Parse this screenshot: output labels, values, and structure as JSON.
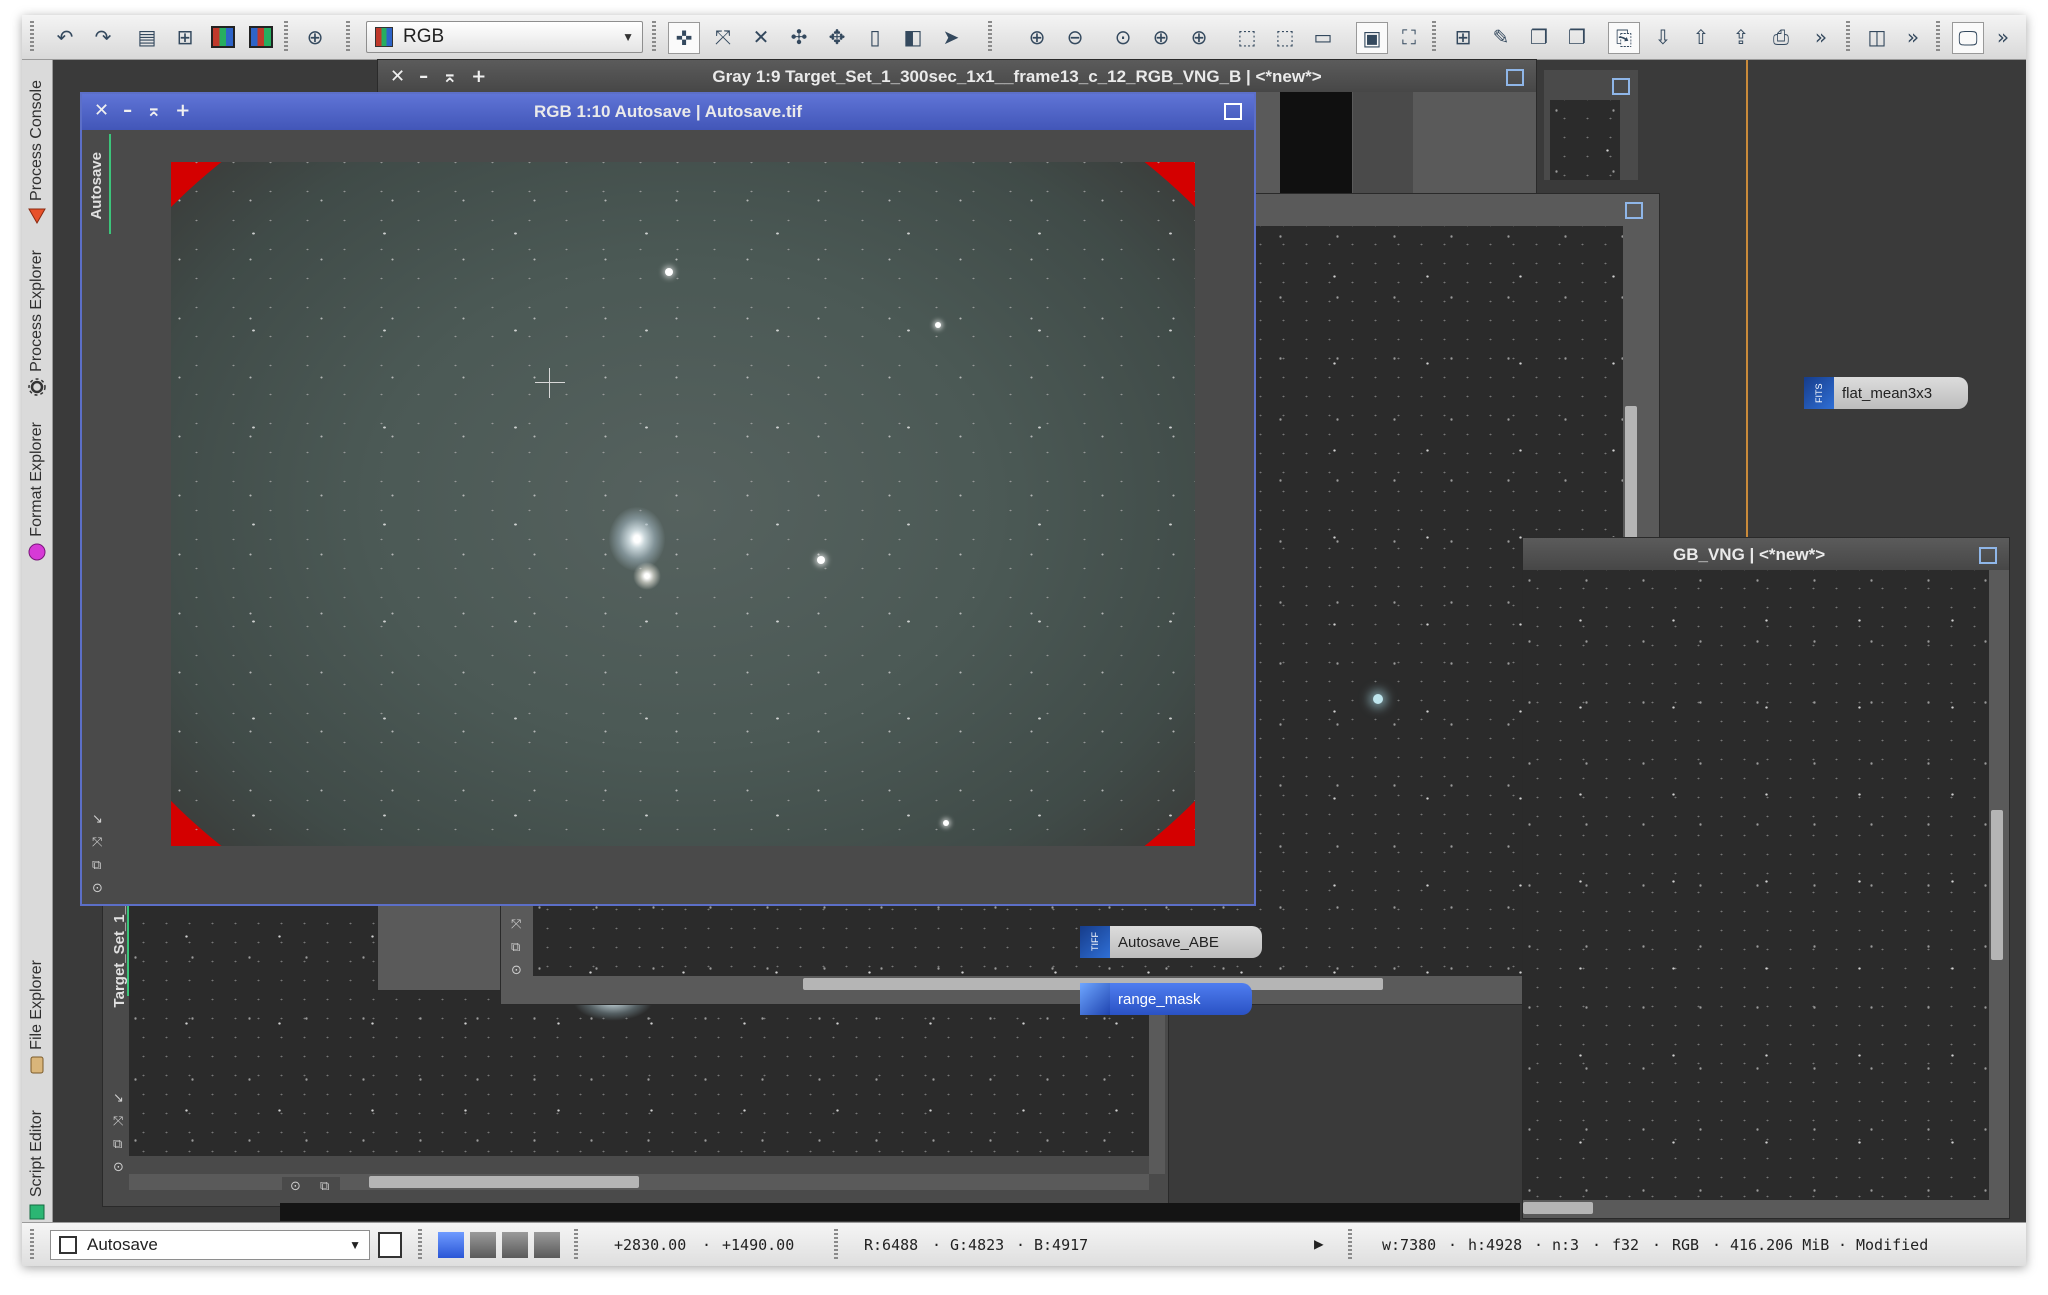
{
  "toolbar": {
    "color_mode": "RGB",
    "icons": [
      "undo-icon",
      "redo-icon",
      "process-icon",
      "new-image-icon",
      "rgb-icon",
      "rgb-alt-icon",
      "new-window-icon",
      "pan-icon",
      "fit-icon",
      "zoom-extents-icon",
      "move-icon",
      "navigate-icon",
      "readout-icon",
      "readout-alt-icon",
      "pointer-icon",
      "zoom-in-icon",
      "zoom-out-icon",
      "zoom-1-icon",
      "zoom-in-alt-icon",
      "zoom-out-alt-icon",
      "preview-icon",
      "preview-edit-icon",
      "preview-reset-icon",
      "fit-view-icon",
      "full-screen-icon",
      "add-icon",
      "edit-icon",
      "stack-icon",
      "stack-alt-icon",
      "script-icon",
      "import-icon",
      "export-icon",
      "share-icon",
      "overflow-icon",
      "panel-icon",
      "overflow-alt-icon",
      "monitor-icon",
      "overflow-end-icon"
    ],
    "overflow_glyph": "»"
  },
  "sidebar": {
    "tabs": [
      {
        "label": "Process Console",
        "icon": "console-icon"
      },
      {
        "label": "Process Explorer",
        "icon": "gear-icon"
      },
      {
        "label": "Format Explorer",
        "icon": "format-icon"
      },
      {
        "label": "File Explorer",
        "icon": "folder-icon"
      },
      {
        "label": "Script Editor",
        "icon": "script-editor-icon"
      }
    ]
  },
  "windows": {
    "gray": {
      "title": "Gray 1:9 Target_Set_1_300sec_1x1__frame13_c_12_RGB_VNG_B | <*new*>"
    },
    "main": {
      "title": "RGB 1:10 Autosave | Autosave.tif",
      "side_tab": "Autosave"
    },
    "right": {
      "title": "GB_VNG | <*new*>"
    },
    "bottom_left": {
      "side_tab": "Target_Set_1_"
    }
  },
  "window_buttons": {
    "close": "✕",
    "minimize": "–",
    "shade": "⌅",
    "plus": "+"
  },
  "icons_on_desktop": [
    {
      "label": "flat_mean3x3",
      "badge": "FITS"
    },
    {
      "label": "Autosave_ABE",
      "badge": "TIFF"
    },
    {
      "label": "range_mask",
      "badge": ""
    }
  ],
  "statusbar": {
    "view": "Autosave",
    "x": "+2830.00",
    "y": "+1490.00",
    "sep": "·",
    "r": "R:6488",
    "g": "G:4823",
    "b": "B:4917",
    "w": "w:7380",
    "h": "h:4928",
    "n": "n:3",
    "format": "f32",
    "mode": "RGB",
    "size": "416.206 MiB",
    "state": "Modified",
    "play_glyph": "▶"
  },
  "colors": {
    "accent_title": "#4a5ec4",
    "vignette_red": "#d40000",
    "sky": "#4b5955"
  }
}
